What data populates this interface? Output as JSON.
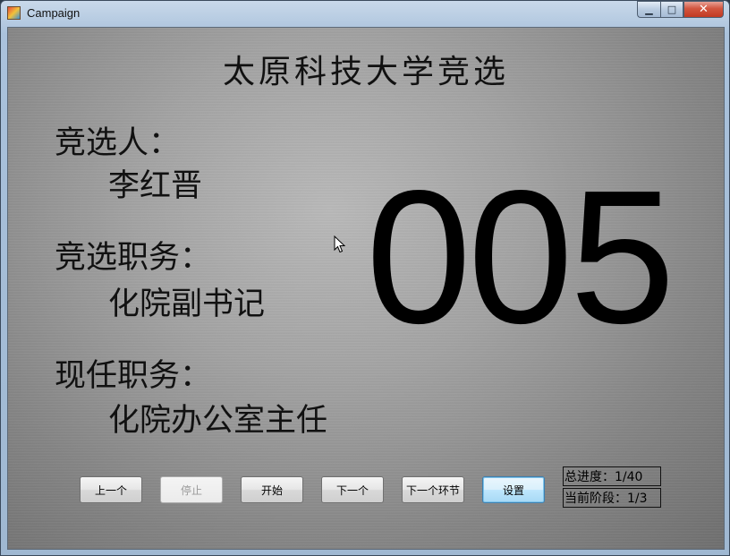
{
  "window": {
    "title": "Campaign",
    "min_glyph": "▁",
    "max_glyph": "□",
    "close_glyph": "✕"
  },
  "main": {
    "heading": "太原科技大学竞选",
    "candidate_label": "竞选人：",
    "candidate_value": "李红晋",
    "position_label": "竞选职务：",
    "position_value": "化院副书记",
    "current_label": "现任职务：",
    "current_value": "化院办公室主任",
    "number": "005"
  },
  "buttons": {
    "prev": "上一个",
    "stop": "停止",
    "start": "开始",
    "next": "下一个",
    "next_stage": "下一个环节",
    "settings": "设置"
  },
  "status": {
    "total_progress": "总进度：1/40",
    "current_stage": "当前阶段：1/3"
  }
}
